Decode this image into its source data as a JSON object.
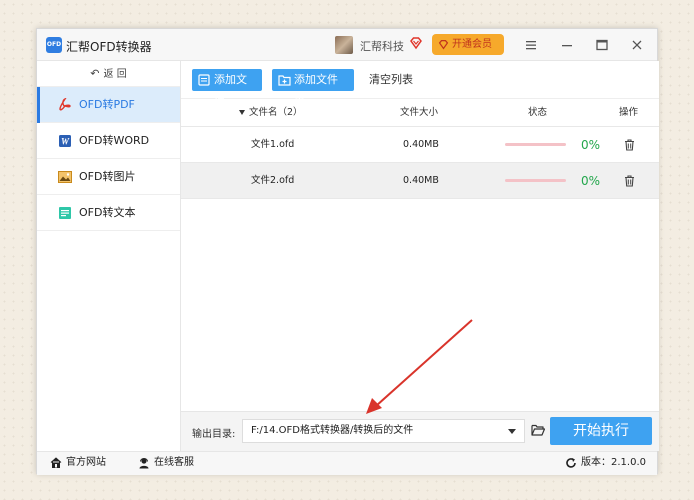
{
  "window": {
    "app_logo_text": "OFD",
    "title": "汇帮OFD转换器"
  },
  "user": {
    "name": "汇帮科技",
    "vip_label": "开通会员"
  },
  "sidebar": {
    "back_label": "返  回",
    "items": [
      {
        "label": "OFD转PDF",
        "icon": "pdf-icon",
        "active": true
      },
      {
        "label": "OFD转WORD",
        "icon": "word-icon",
        "active": false
      },
      {
        "label": "OFD转图片",
        "icon": "image-icon",
        "active": false
      },
      {
        "label": "OFD转文本",
        "icon": "text-icon",
        "active": false
      }
    ]
  },
  "toolbar": {
    "add_file": "添加文件",
    "add_folder": "添加文件夹",
    "clear_list": "清空列表"
  },
  "table": {
    "headers": {
      "name": "文件名（2）",
      "size": "文件大小",
      "status": "状态",
      "action": "操作"
    },
    "rows": [
      {
        "name": "文件1.ofd",
        "size": "0.40MB",
        "progress": "0%",
        "progress_fraction": 0
      },
      {
        "name": "文件2.ofd",
        "size": "0.40MB",
        "progress": "0%",
        "progress_fraction": 0
      }
    ]
  },
  "output": {
    "label": "输出目录:",
    "path": "F:/14.OFD格式转换器/转换后的文件",
    "run_label": "开始执行"
  },
  "statusbar": {
    "website": "官方网站",
    "service": "在线客服",
    "version": "版本：2.1.0.0"
  },
  "colors": {
    "accent": "#3ea2f1",
    "vip": "#f6a92b",
    "progress_track": "#f4c2c7",
    "percent": "#22a64b",
    "annotation_arrow": "#d9342b"
  }
}
